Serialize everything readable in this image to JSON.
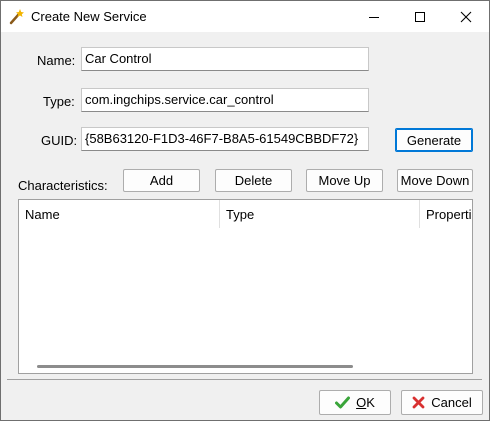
{
  "window": {
    "title": "Create New Service",
    "icon": "wand-icon",
    "controls": {
      "minimize": "minimize-icon",
      "maximize": "maximize-icon",
      "close": "close-icon"
    }
  },
  "form": {
    "name_label": "Name:",
    "name_value": "Car Control",
    "type_label": "Type:",
    "type_value": "com.ingchips.service.car_control",
    "guid_label": "GUID:",
    "guid_value": "{58B63120-F1D3-46F7-B8A5-61549CBBDF72}",
    "generate_label": "Generate"
  },
  "characteristics": {
    "label": "Characteristics:",
    "buttons": {
      "add": "Add",
      "delete": "Delete",
      "move_up": "Move Up",
      "move_down": "Move Down"
    },
    "columns": [
      "Name",
      "Type",
      "Properties"
    ]
  },
  "footer": {
    "ok_prefix": "",
    "ok_mnemonic": "O",
    "ok_rest": "K",
    "cancel_label": "Cancel",
    "ok_icon": "checkmark-icon",
    "cancel_icon": "x-icon",
    "ok_icon_color": "#3aa53a",
    "cancel_icon_color": "#d83030"
  }
}
